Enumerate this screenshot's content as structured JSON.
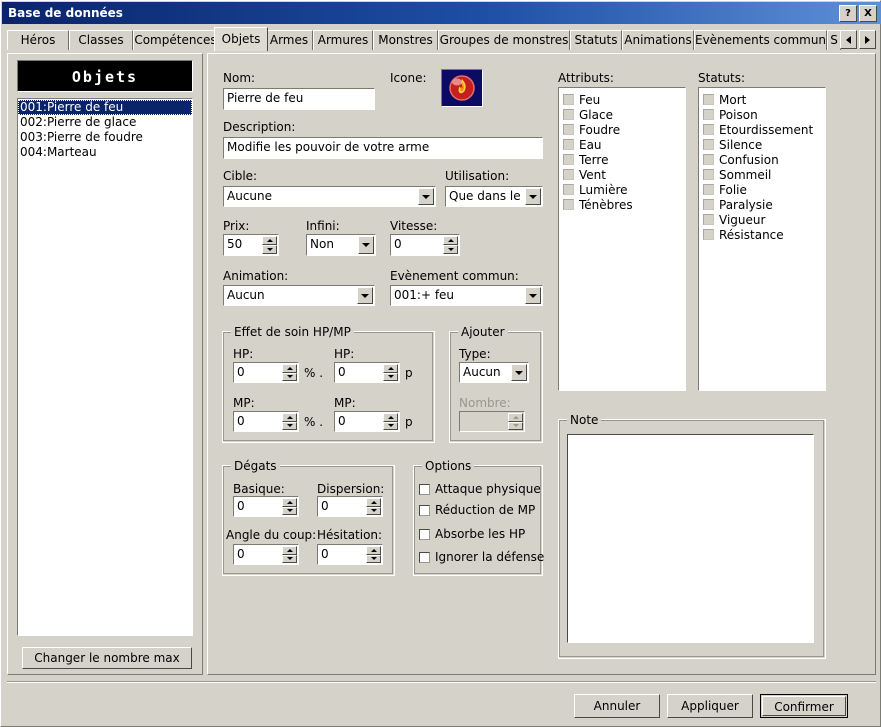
{
  "window": {
    "title": "Base de données",
    "help_button": "?",
    "close_button": "X"
  },
  "tabs": {
    "items": [
      {
        "label": "Héros",
        "selected": false
      },
      {
        "label": "Classes",
        "selected": false
      },
      {
        "label": "Compétences",
        "selected": false
      },
      {
        "label": "Objets",
        "selected": true
      },
      {
        "label": "Armes",
        "selected": false
      },
      {
        "label": "Armures",
        "selected": false
      },
      {
        "label": "Monstres",
        "selected": false
      },
      {
        "label": "Groupes de monstres",
        "selected": false
      },
      {
        "label": "Statuts",
        "selected": false
      },
      {
        "label": "Animations",
        "selected": false
      },
      {
        "label": "Evènements commun",
        "selected": false
      },
      {
        "label": "S",
        "selected": false
      }
    ],
    "scroll_left": "left-arrow",
    "scroll_right": "right-arrow"
  },
  "sidebar": {
    "header": "Objets",
    "items": [
      {
        "label": "001:Pierre de feu",
        "selected": true
      },
      {
        "label": "002:Pierre de glace",
        "selected": false
      },
      {
        "label": "003:Pierre de foudre",
        "selected": false
      },
      {
        "label": "004:Marteau",
        "selected": false
      }
    ],
    "change_max_button": "Changer le nombre max"
  },
  "form": {
    "nom_label": "Nom:",
    "nom_value": "Pierre de feu",
    "icone_label": "Icone:",
    "icone_name": "fire-orb-icon",
    "description_label": "Description:",
    "description_value": "Modifie les pouvoir de votre arme",
    "cible_label": "Cible:",
    "cible_value": "Aucune",
    "utilisation_label": "Utilisation:",
    "utilisation_value": "Que dans le r",
    "prix_label": "Prix:",
    "prix_value": "50",
    "infini_label": "Infini:",
    "infini_value": "Non",
    "vitesse_label": "Vitesse:",
    "vitesse_value": "0",
    "animation_label": "Animation:",
    "animation_value": "Aucun",
    "evenement_label": "Evènement commun:",
    "evenement_value": "001:+ feu"
  },
  "soin": {
    "title": "Effet de soin HP/MP",
    "hp_pct_label": "HP:",
    "hp_pct_value": "0",
    "hp_pct_unit": "% .",
    "hp_flat_label": "HP:",
    "hp_flat_value": "0",
    "hp_flat_unit": "p",
    "mp_pct_label": "MP:",
    "mp_pct_value": "0",
    "mp_pct_unit": "% .",
    "mp_flat_label": "MP:",
    "mp_flat_value": "0",
    "mp_flat_unit": "p"
  },
  "ajouter": {
    "title": "Ajouter",
    "type_label": "Type:",
    "type_value": "Aucun",
    "nombre_label": "Nombre:",
    "nombre_value": ""
  },
  "degats": {
    "title": "Dégats",
    "basique_label": "Basique:",
    "basique_value": "0",
    "dispersion_label": "Dispersion:",
    "dispersion_value": "0",
    "angle_label": "Angle du coup:",
    "angle_value": "0",
    "hesitation_label": "Hésitation:",
    "hesitation_value": "0"
  },
  "options": {
    "title": "Options",
    "items": [
      {
        "label": "Attaque physique",
        "checked": false
      },
      {
        "label": "Réduction de MP",
        "checked": false
      },
      {
        "label": "Absorbe les HP",
        "checked": false
      },
      {
        "label": "Ignorer la défense",
        "checked": false
      }
    ]
  },
  "attributs": {
    "label": "Attributs:",
    "items": [
      {
        "label": "Feu",
        "checked": false
      },
      {
        "label": "Glace",
        "checked": false
      },
      {
        "label": "Foudre",
        "checked": false
      },
      {
        "label": "Eau",
        "checked": false
      },
      {
        "label": "Terre",
        "checked": false
      },
      {
        "label": "Vent",
        "checked": false
      },
      {
        "label": "Lumière",
        "checked": false
      },
      {
        "label": "Ténèbres",
        "checked": false
      }
    ]
  },
  "statuts": {
    "label": "Statuts:",
    "items": [
      {
        "label": "Mort",
        "checked": false
      },
      {
        "label": "Poison",
        "checked": false
      },
      {
        "label": "Etourdissement",
        "checked": false
      },
      {
        "label": "Silence",
        "checked": false
      },
      {
        "label": "Confusion",
        "checked": false
      },
      {
        "label": "Sommeil",
        "checked": false
      },
      {
        "label": "Folie",
        "checked": false
      },
      {
        "label": "Paralysie",
        "checked": false
      },
      {
        "label": "Vigueur",
        "checked": false
      },
      {
        "label": "Résistance",
        "checked": false
      }
    ]
  },
  "note": {
    "title": "Note",
    "value": ""
  },
  "footer": {
    "cancel": "Annuler",
    "apply": "Appliquer",
    "confirm": "Confirmer"
  },
  "colors": {
    "titlebar_start": "#0a246a",
    "titlebar_end": "#5e90d8",
    "face": "#d5d2ca",
    "selection": "#0a246a"
  }
}
